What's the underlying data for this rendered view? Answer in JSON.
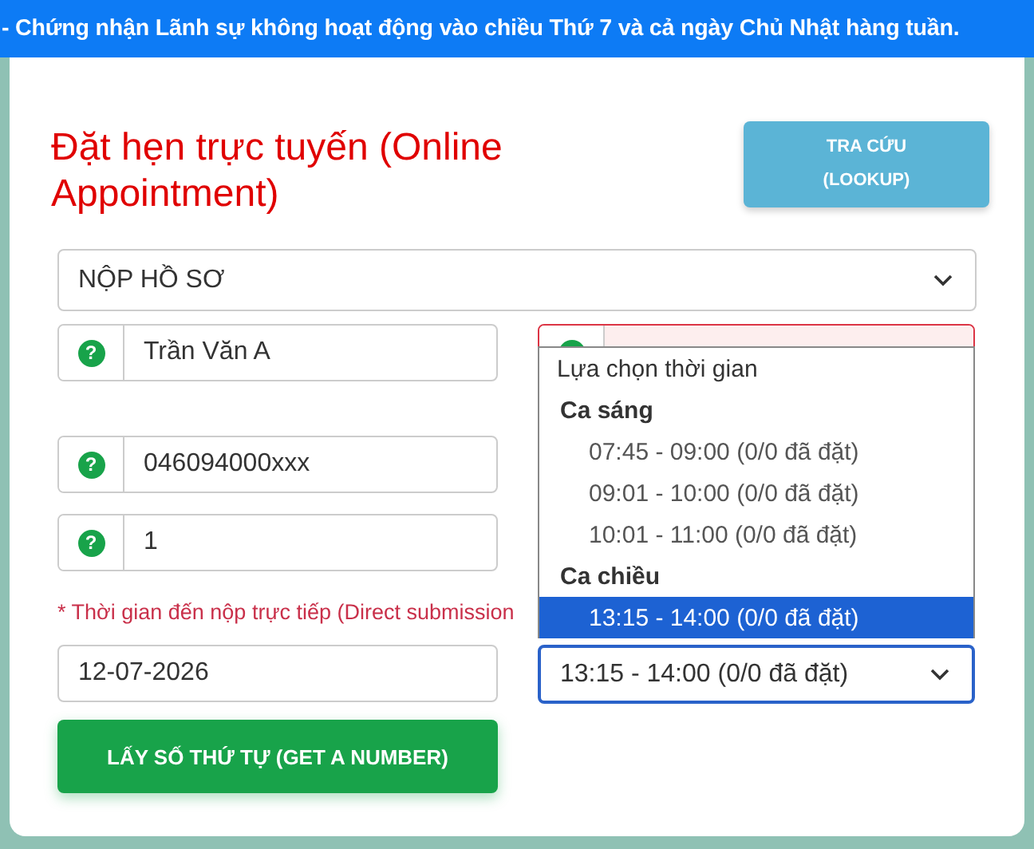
{
  "banner": {
    "text": "- Chứng nhận Lãnh sự không hoạt động vào chiều Thứ 7 và cả ngày Chủ Nhật hàng tuần."
  },
  "title": "Đặt hẹn trực tuyến (Online Appointment)",
  "lookup_button": {
    "label": "TRA CỨU (LOOKUP)"
  },
  "service_select": {
    "value": "NỘP HỒ SƠ"
  },
  "fields": [
    {
      "icon": "?",
      "value": "Trần Văn A"
    },
    {
      "icon": "?",
      "value": "046094000xxx"
    },
    {
      "icon": "?",
      "value": "1"
    }
  ],
  "phone_field": {
    "invalid": true
  },
  "note": "* Thời gian đến nộp trực tiếp (Direct submission",
  "date_field": {
    "value": "12-07-2026"
  },
  "time_select": {
    "value": "13:15 - 14:00 (0/0 đã đặt)",
    "expanded": true
  },
  "time_dropdown": {
    "prompt": "Lựa chọn thời gian",
    "groups": [
      {
        "label": "Ca sáng",
        "options": [
          {
            "label": "07:45 - 09:00 (0/0 đã đặt)",
            "selected": false
          },
          {
            "label": "09:01 - 10:00 (0/0 đã đặt)",
            "selected": false
          },
          {
            "label": "10:01 - 11:00 (0/0 đã đặt)",
            "selected": false
          }
        ]
      },
      {
        "label": "Ca chiều",
        "options": [
          {
            "label": "13:15 - 14:00 (0/0 đã đặt)",
            "selected": true
          }
        ]
      }
    ]
  },
  "submit_button": {
    "label": "LẤY SỐ THỨ TỰ (GET A NUMBER)"
  }
}
